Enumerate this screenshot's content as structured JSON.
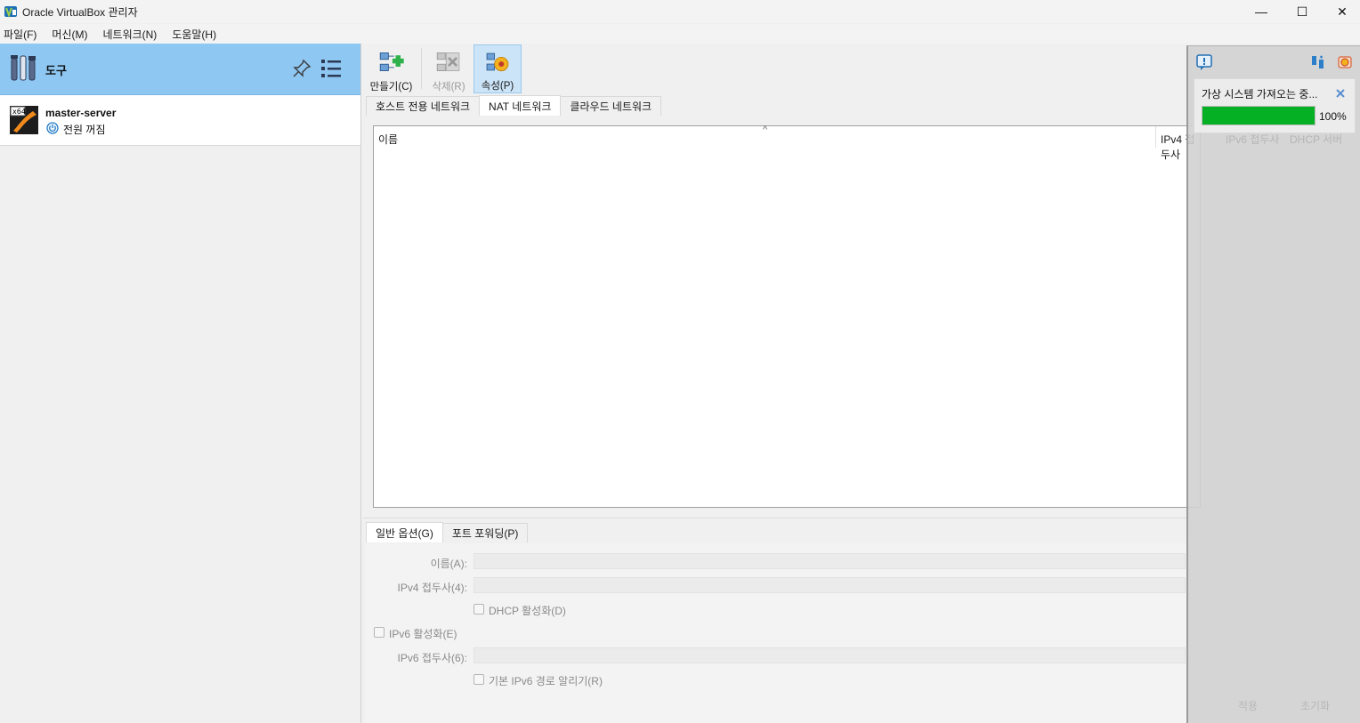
{
  "window": {
    "title": "Oracle VirtualBox 관리자",
    "min_glyph": "—",
    "max_glyph": "☐",
    "close_glyph": "✕"
  },
  "menu": {
    "items": [
      "파일(F)",
      "머신(M)",
      "네트워크(N)",
      "도움말(H)"
    ]
  },
  "sidebar": {
    "tools_label": "도구",
    "vm": {
      "name": "master-server",
      "state": "전원 꺼짐",
      "badge": "x64"
    }
  },
  "toolbar": {
    "create_label": "만들기(C)",
    "delete_label": "삭제(R)",
    "properties_label": "속성(P)"
  },
  "network_tabs": [
    "호스트 전용 네트워크",
    "NAT 네트워크",
    "클라우드 네트워크"
  ],
  "network_tabs_active": 1,
  "table": {
    "col_name": "이름",
    "col_ipv4": "IPv4 접두사",
    "col_ipv6": "IPv6 접두사",
    "col_dhcp": "DHCP 서버",
    "sort_glyph": "^"
  },
  "detail_tabs": [
    "일반 옵션(G)",
    "포트 포워딩(P)"
  ],
  "detail_tabs_active": 0,
  "form": {
    "name_label": "이름(A):",
    "ipv4_label": "IPv4 접두사(4):",
    "dhcp_label": "DHCP 활성화(D)",
    "ipv6_enable_label": "IPv6 활성화(E)",
    "ipv6_label": "IPv6 접두사(6):",
    "ipv6_route_label": "기본 IPv6 경로 알리기(R)",
    "apply_label": "적용",
    "reset_label": "초기화"
  },
  "notification": {
    "title": "가상 시스템 가져오는 중...",
    "progress_percent": 100,
    "progress_text": "100%",
    "progress_color": "#06b025"
  },
  "colors": {
    "selected_tools_bg": "#8ec7f2",
    "pressed_button_bg": "#cce4f7"
  }
}
